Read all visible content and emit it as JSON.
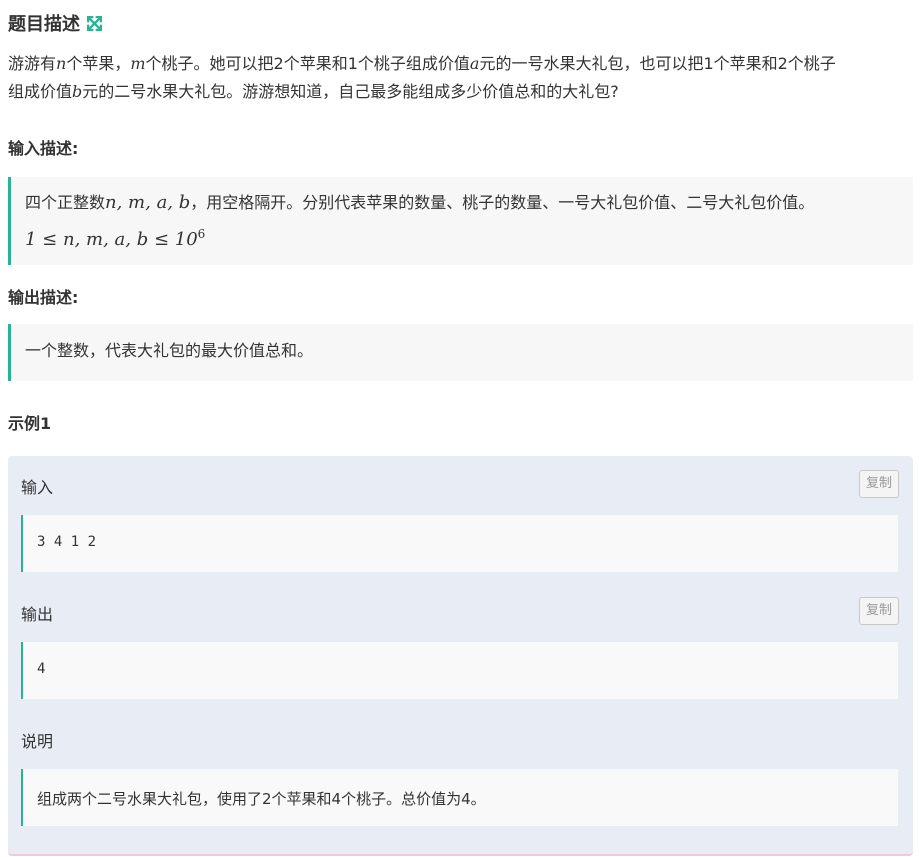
{
  "problem": {
    "title": "题目描述",
    "desc_line1": [
      "游游有",
      "n",
      "个苹果，",
      "m",
      "个桃子。她可以把2个苹果和1个桃子组成价值",
      "a",
      "元的一号水果大礼包，也可以把1个苹果和2个桃子"
    ],
    "desc_line2": [
      "组成价值",
      "b",
      "元的二号水果大礼包。游游想知道，自己最多能组成多少价值总和的大礼包?"
    ]
  },
  "input_section": {
    "heading": "输入描述:",
    "line1_prefix": "四个正整数",
    "line1_vars": "n, m, a, b",
    "line1_suffix": "，用空格隔开。分别代表苹果的数量、桃子的数量、一号大礼包价值、二号大礼包价值。",
    "constraint": "1 ≤ n, m, a, b ≤ 10",
    "constraint_exp": "6"
  },
  "output_section": {
    "heading": "输出描述:",
    "text": "一个整数，代表大礼包的最大价值总和。"
  },
  "example": {
    "heading": "示例1",
    "input_label": "输入",
    "input_value": "3 4 1 2",
    "output_label": "输出",
    "output_value": "4",
    "copy_label": "复制",
    "explain_label": "说明",
    "explain_text": "组成两个二号水果大礼包，使用了2个苹果和4个桃子。总价值为4。"
  },
  "colors": {
    "accent": "#2bb294",
    "example_bg": "#e8edf5",
    "quote_bg": "#f7f7f7"
  }
}
